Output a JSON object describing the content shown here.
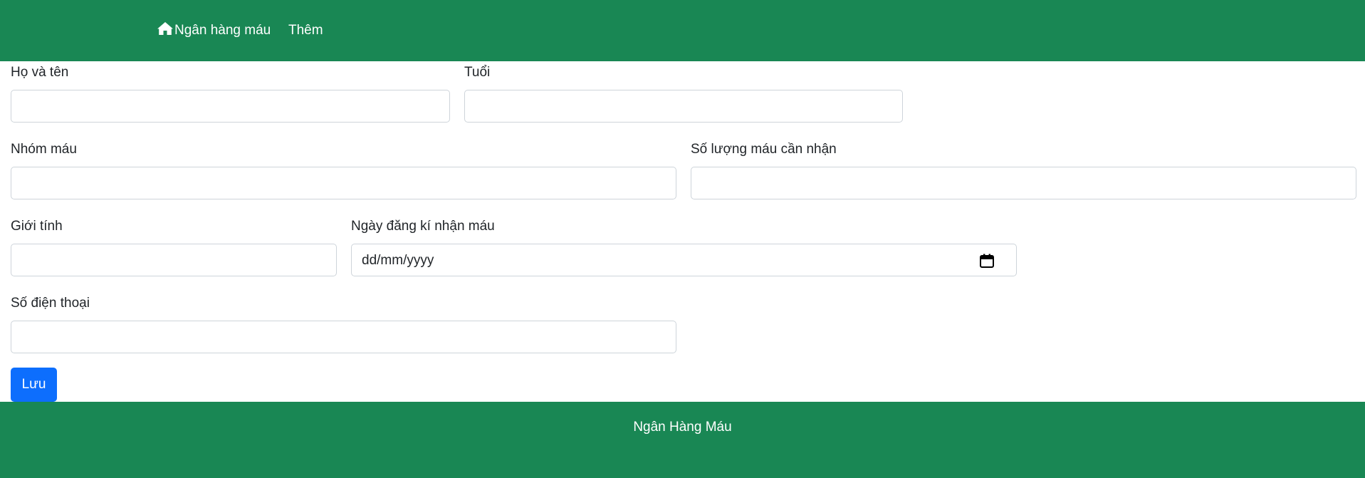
{
  "navbar": {
    "brand_label": "Ngân hàng máu",
    "brand_icon": "home-icon",
    "link_add": "Thêm",
    "color": "#198754"
  },
  "form": {
    "full_name": {
      "label": "Họ và tên",
      "value": ""
    },
    "age": {
      "label": "Tuổi",
      "value": ""
    },
    "blood_group": {
      "label": "Nhóm máu",
      "value": ""
    },
    "blood_amount": {
      "label": "Số lượng máu cần nhận",
      "value": ""
    },
    "gender": {
      "label": "Giới tính",
      "value": ""
    },
    "register_date": {
      "label": "Ngày đăng kí nhận máu",
      "placeholder": "dd/mm/yyyy",
      "icon": "calendar-icon"
    },
    "phone": {
      "label": "Số điện thoại",
      "value": ""
    },
    "save_label": "Lưu",
    "save_color": "#0d6efd"
  },
  "footer": {
    "text": "Ngân Hàng Máu"
  }
}
